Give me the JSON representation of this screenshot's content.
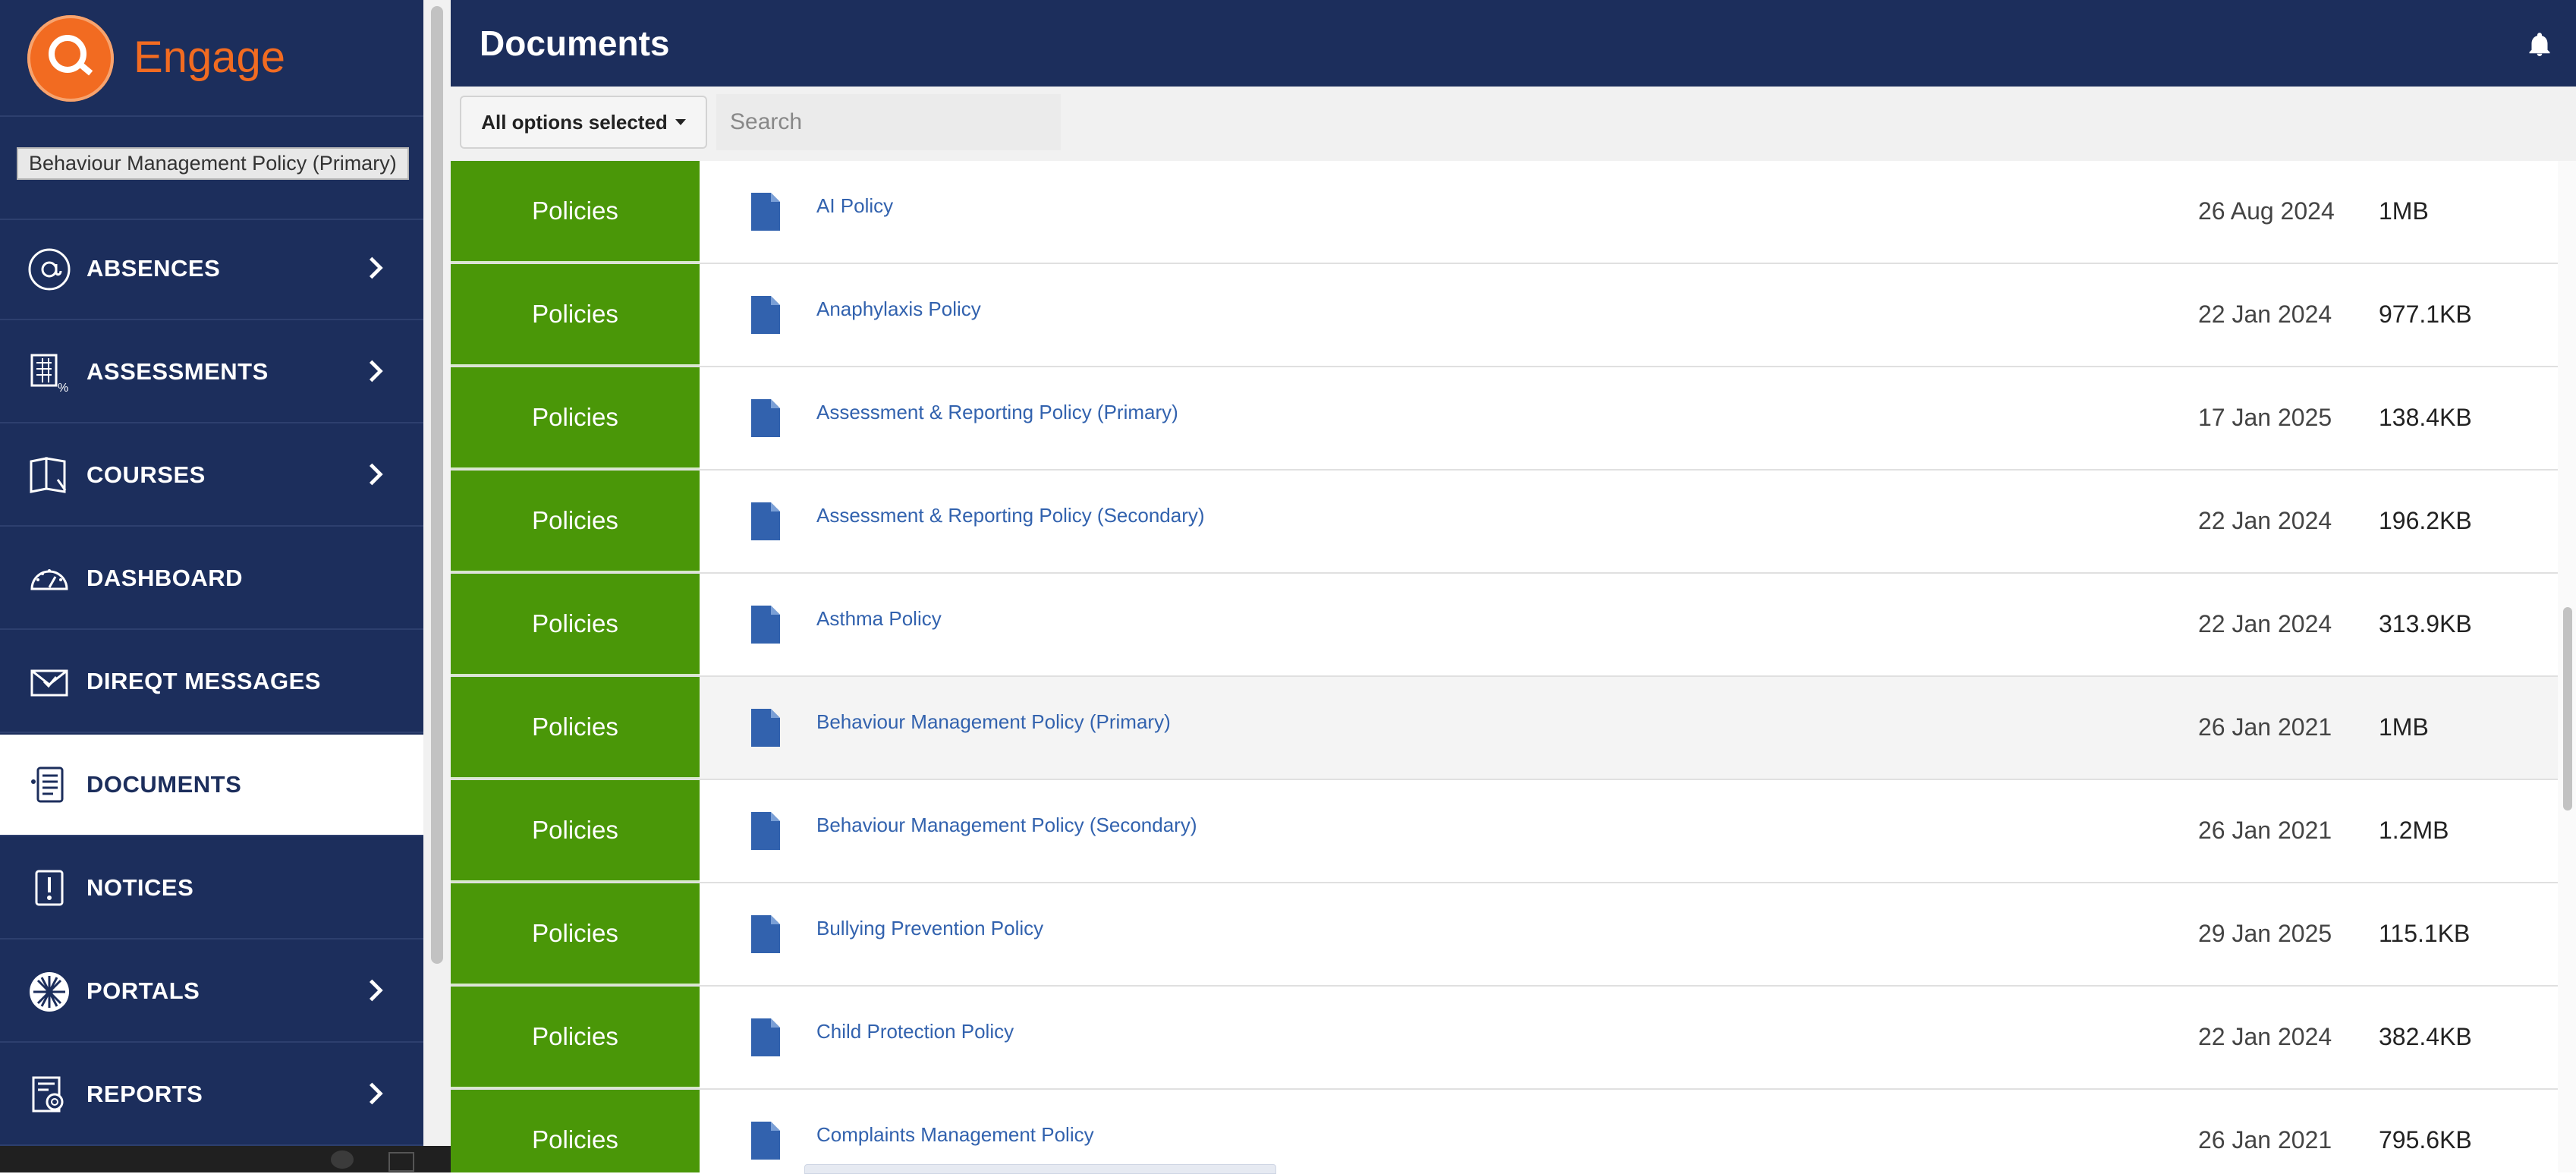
{
  "app": {
    "name": "Engage"
  },
  "tooltip": "Behaviour Management Policy (Primary)",
  "sidebar": {
    "items": [
      {
        "label": "ABSENCES",
        "icon": "at-sign-icon",
        "has_chevron": true
      },
      {
        "label": "ASSESSMENTS",
        "icon": "gradebook-icon",
        "has_chevron": true
      },
      {
        "label": "COURSES",
        "icon": "book-icon",
        "has_chevron": true
      },
      {
        "label": "DASHBOARD",
        "icon": "speedometer-icon",
        "has_chevron": false
      },
      {
        "label": "DIREQT MESSAGES",
        "icon": "envelope-icon",
        "has_chevron": false
      },
      {
        "label": "DOCUMENTS",
        "icon": "document-list-icon",
        "has_chevron": false,
        "active": true
      },
      {
        "label": "NOTICES",
        "icon": "notice-icon",
        "has_chevron": false
      },
      {
        "label": "PORTALS",
        "icon": "portal-icon",
        "has_chevron": true
      },
      {
        "label": "REPORTS",
        "icon": "report-icon",
        "has_chevron": true
      }
    ]
  },
  "header": {
    "title": "Documents",
    "bell_icon": "bell-icon"
  },
  "filter": {
    "options_label": "All options selected",
    "search_placeholder": "Search"
  },
  "documents": [
    {
      "category": "Policies",
      "name": "AI Policy",
      "date": "26 Aug 2024",
      "size": "1MB"
    },
    {
      "category": "Policies",
      "name": "Anaphylaxis Policy",
      "date": "22 Jan 2024",
      "size": "977.1KB"
    },
    {
      "category": "Policies",
      "name": "Assessment & Reporting Policy (Primary)",
      "date": "17 Jan 2025",
      "size": "138.4KB"
    },
    {
      "category": "Policies",
      "name": "Assessment & Reporting Policy (Secondary)",
      "date": "22 Jan 2024",
      "size": "196.2KB"
    },
    {
      "category": "Policies",
      "name": "Asthma Policy",
      "date": "22 Jan 2024",
      "size": "313.9KB"
    },
    {
      "category": "Policies",
      "name": "Behaviour Management Policy (Primary)",
      "date": "26 Jan 2021",
      "size": "1MB"
    },
    {
      "category": "Policies",
      "name": "Behaviour Management Policy (Secondary)",
      "date": "26 Jan 2021",
      "size": "1.2MB"
    },
    {
      "category": "Policies",
      "name": "Bullying Prevention Policy",
      "date": "29 Jan 2025",
      "size": "115.1KB"
    },
    {
      "category": "Policies",
      "name": "Child Protection Policy",
      "date": "22 Jan 2024",
      "size": "382.4KB"
    },
    {
      "category": "Policies",
      "name": "Complaints Management Policy",
      "date": "26 Jan 2021",
      "size": "795.6KB"
    }
  ],
  "colors": {
    "sidebar_bg": "#1c2e5c",
    "brand_orange": "#f26b21",
    "category_green": "#4a9708",
    "link_blue": "#3262ae"
  }
}
